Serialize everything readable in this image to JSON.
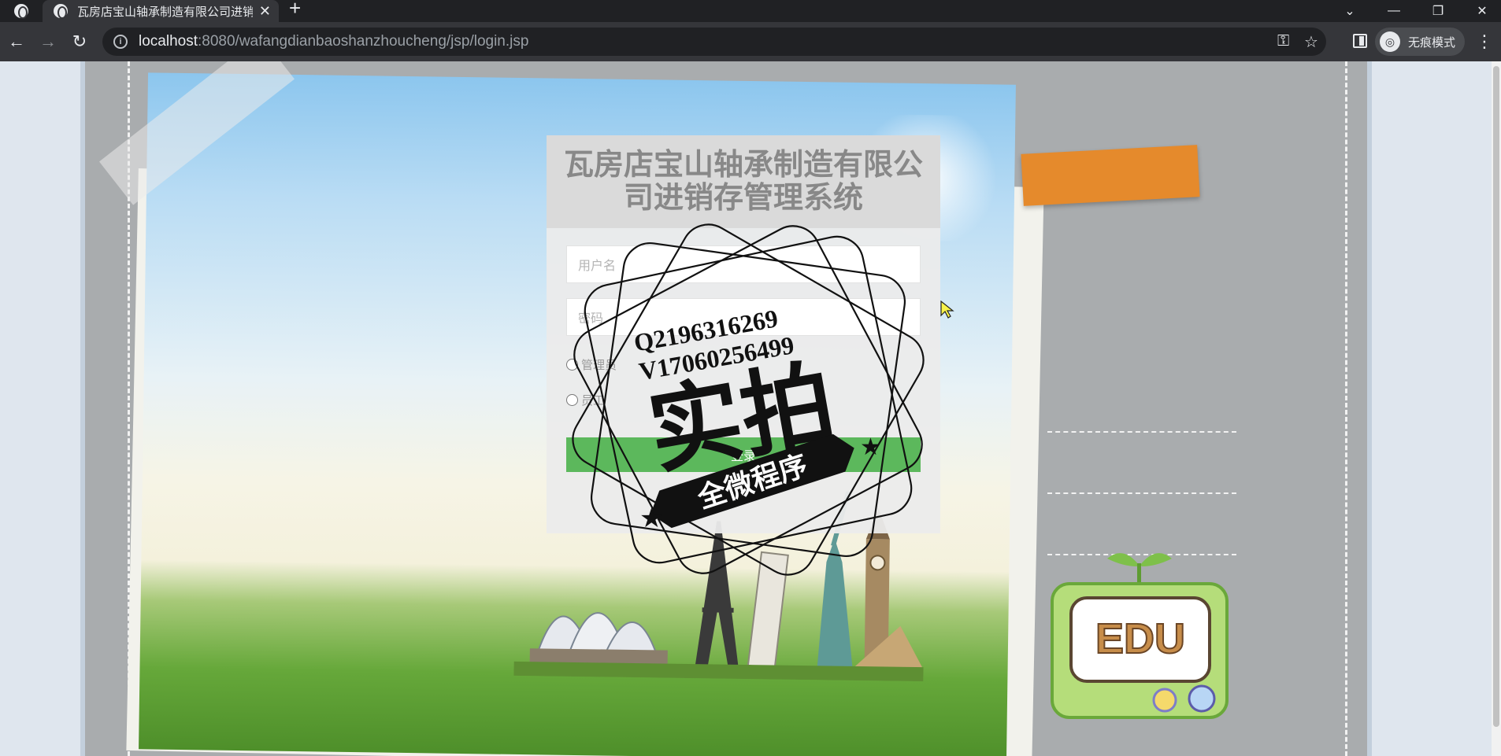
{
  "browser": {
    "tab_title": "瓦房店宝山轴承制造有限公司进销存管理系统",
    "url_host": "localhost",
    "url_rest": ":8080/wafangdianbaoshanzhoucheng/jsp/login.jsp",
    "incognito_label": "无痕模式"
  },
  "login": {
    "title": "瓦房店宝山轴承制造有限公司进销存管理系统",
    "username_placeholder": "用户名",
    "password_placeholder": "密码",
    "role_admin": "管理员",
    "role_employee": "员工",
    "submit_label": "登录",
    "submit_color": "#5cb85c"
  },
  "watermark": {
    "line1": "Q2196316269",
    "line2": "V17060256499",
    "big": "实拍",
    "banner": "全微程序"
  },
  "badge": {
    "text": "EDU"
  }
}
